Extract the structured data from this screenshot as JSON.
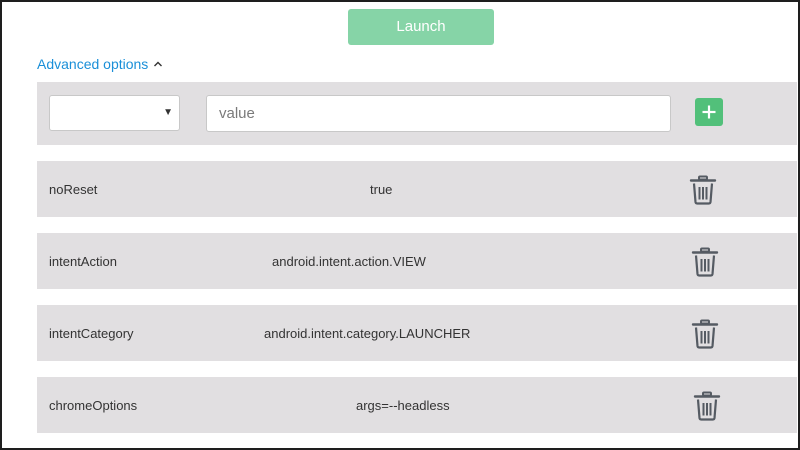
{
  "launch_button": {
    "label": "Launch"
  },
  "advanced_options": {
    "label": "Advanced options",
    "expanded": true
  },
  "new_capability": {
    "selected_type": "",
    "value": "",
    "value_placeholder": "value",
    "add_icon": "plus-icon"
  },
  "capabilities": [
    {
      "name": "noReset",
      "value": "true",
      "delete_icon": "trash-icon"
    },
    {
      "name": "intentAction",
      "value": "android.intent.action.VIEW",
      "delete_icon": "trash-icon"
    },
    {
      "name": "intentCategory",
      "value": "android.intent.category.LAUNCHER",
      "delete_icon": "trash-icon"
    },
    {
      "name": "chromeOptions",
      "value": "args=--headless",
      "delete_icon": "trash-icon"
    }
  ],
  "colors": {
    "launch_bg": "#86d4a7",
    "link": "#1a8fd8",
    "add_bg": "#52c07a",
    "row_bg": "#e1dfe1",
    "trash_stroke": "#555b63"
  }
}
